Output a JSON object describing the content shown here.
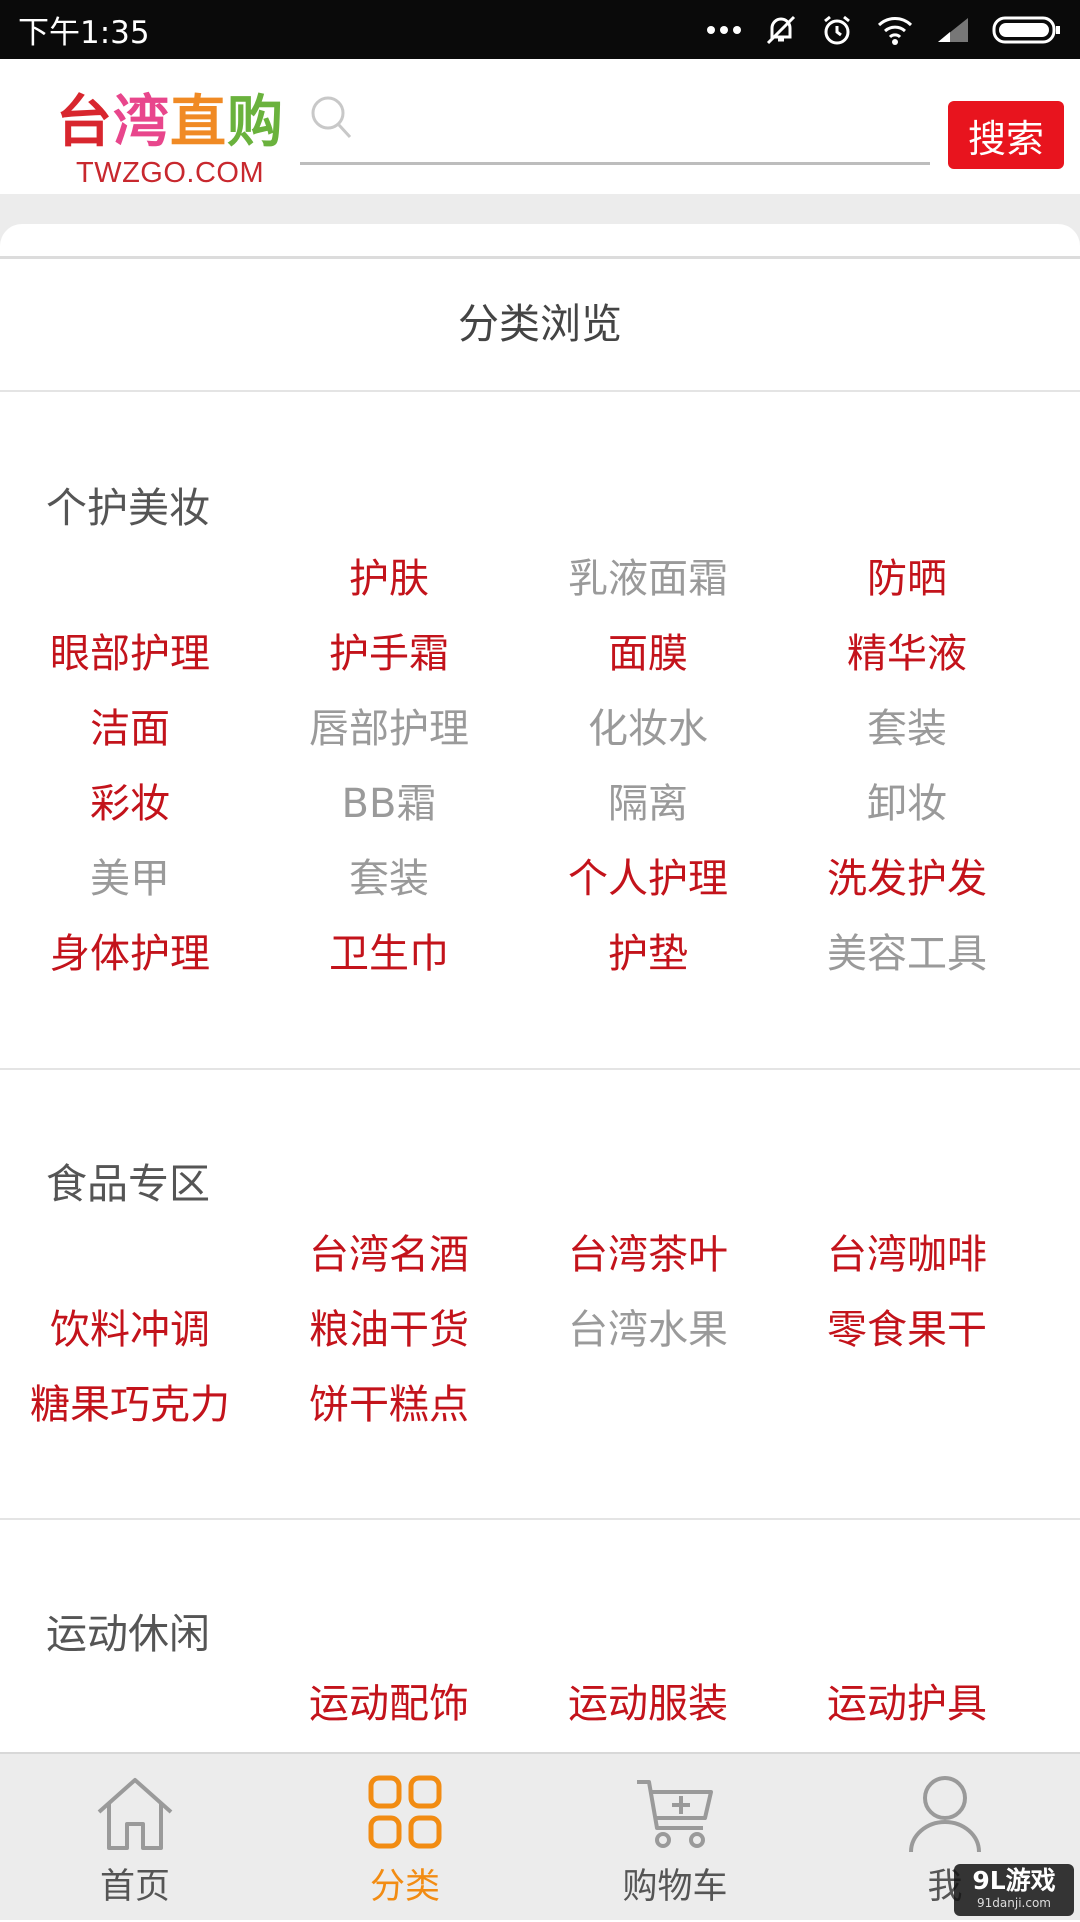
{
  "status_bar": {
    "time": "下午1:35"
  },
  "header": {
    "logo_cn": [
      "台",
      "湾",
      "直",
      "购"
    ],
    "logo_en": "TWZGO.COM",
    "search_placeholder": "",
    "search_button": "搜索"
  },
  "page_title": "分类浏览",
  "sections": [
    {
      "title": "个护美妆",
      "items": [
        {
          "label": "",
          "active": false
        },
        {
          "label": "护肤",
          "active": true
        },
        {
          "label": "乳液面霜",
          "active": false
        },
        {
          "label": "防晒",
          "active": true
        },
        {
          "label": "眼部护理",
          "active": true
        },
        {
          "label": "护手霜",
          "active": true
        },
        {
          "label": "面膜",
          "active": true
        },
        {
          "label": "精华液",
          "active": true
        },
        {
          "label": "洁面",
          "active": true
        },
        {
          "label": "唇部护理",
          "active": false
        },
        {
          "label": "化妆水",
          "active": false
        },
        {
          "label": "套装",
          "active": false
        },
        {
          "label": "彩妆",
          "active": true
        },
        {
          "label": "BB霜",
          "active": false
        },
        {
          "label": "隔离",
          "active": false
        },
        {
          "label": "卸妆",
          "active": false
        },
        {
          "label": "美甲",
          "active": false
        },
        {
          "label": "套装",
          "active": false
        },
        {
          "label": "个人护理",
          "active": true
        },
        {
          "label": "洗发护发",
          "active": true
        },
        {
          "label": "身体护理",
          "active": true
        },
        {
          "label": "卫生巾",
          "active": true
        },
        {
          "label": "护垫",
          "active": true
        },
        {
          "label": "美容工具",
          "active": false
        }
      ]
    },
    {
      "title": "食品专区",
      "items": [
        {
          "label": "",
          "active": false
        },
        {
          "label": "台湾名酒",
          "active": true
        },
        {
          "label": "台湾茶叶",
          "active": true
        },
        {
          "label": "台湾咖啡",
          "active": true
        },
        {
          "label": "饮料冲调",
          "active": true
        },
        {
          "label": "粮油干货",
          "active": true
        },
        {
          "label": "台湾水果",
          "active": false
        },
        {
          "label": "零食果干",
          "active": true
        },
        {
          "label": "糖果巧克力",
          "active": true
        },
        {
          "label": "饼干糕点",
          "active": true
        }
      ]
    },
    {
      "title": "运动休闲",
      "items": [
        {
          "label": "",
          "active": false
        },
        {
          "label": "运动配饰",
          "active": true
        },
        {
          "label": "运动服装",
          "active": true
        },
        {
          "label": "运动护具",
          "active": true
        }
      ]
    }
  ],
  "bottom_nav": [
    {
      "label": "首页",
      "icon": "home-icon",
      "active": false
    },
    {
      "label": "分类",
      "icon": "grid-icon",
      "active": true
    },
    {
      "label": "购物车",
      "icon": "cart-icon",
      "active": false
    },
    {
      "label": "我",
      "icon": "user-icon",
      "active": false
    }
  ],
  "watermark": {
    "main": "9L游戏",
    "sub": "91danji.com"
  },
  "colors": {
    "accent_red": "#c3131b",
    "button_red": "#e8141e",
    "inactive_gray": "#9a9a9a",
    "nav_active": "#f28c13"
  }
}
